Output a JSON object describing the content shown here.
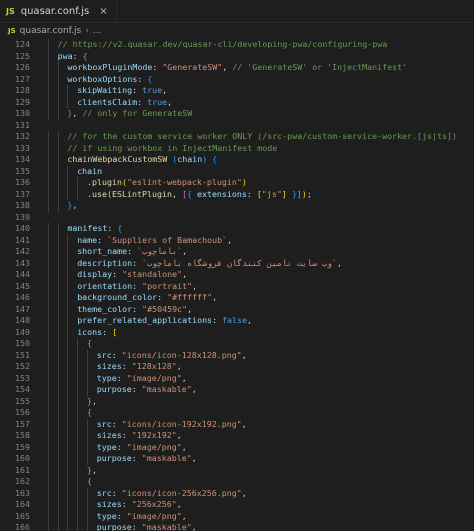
{
  "tab": {
    "badge": "JS",
    "label": "quasar.conf.js",
    "close": "×"
  },
  "breadcrumb": {
    "badge": "JS",
    "file": "quasar.conf.js",
    "sep": "›",
    "tail": "..."
  },
  "lines": [
    {
      "n": "124",
      "indent": 2,
      "tokens": [
        [
          "c",
          "// https://v2.quasar.dev/quasar-cli/developing-pwa/configuring-pwa"
        ]
      ]
    },
    {
      "n": "125",
      "indent": 2,
      "tokens": [
        [
          "k",
          "pwa"
        ],
        [
          "p",
          ": "
        ],
        [
          "b2",
          "{"
        ]
      ]
    },
    {
      "n": "126",
      "indent": 3,
      "tokens": [
        [
          "k",
          "workboxPluginMode"
        ],
        [
          "p",
          ": "
        ],
        [
          "s",
          "\"GenerateSW\""
        ],
        [
          "p",
          ", "
        ],
        [
          "c",
          "// 'GenerateSW' or 'InjectManifest'"
        ]
      ]
    },
    {
      "n": "127",
      "indent": 3,
      "tokens": [
        [
          "k",
          "workboxOptions"
        ],
        [
          "p",
          ": "
        ],
        [
          "b3",
          "{"
        ]
      ]
    },
    {
      "n": "128",
      "indent": 4,
      "tokens": [
        [
          "k",
          "skipWaiting"
        ],
        [
          "p",
          ": "
        ],
        [
          "w",
          "true"
        ],
        [
          "p",
          ","
        ]
      ]
    },
    {
      "n": "129",
      "indent": 4,
      "tokens": [
        [
          "k",
          "clientsClaim"
        ],
        [
          "p",
          ": "
        ],
        [
          "w",
          "true"
        ],
        [
          "p",
          ","
        ]
      ]
    },
    {
      "n": "130",
      "indent": 3,
      "tokens": [
        [
          "b3",
          "}"
        ],
        [
          "p",
          ", "
        ],
        [
          "c",
          "// only for GenerateSW"
        ]
      ]
    },
    {
      "n": "131",
      "indent": 0,
      "tokens": []
    },
    {
      "n": "132",
      "indent": 3,
      "tokens": [
        [
          "c",
          "// for the custom service worker ONLY (/src-pwa/custom-service-worker.[js|ts])"
        ]
      ]
    },
    {
      "n": "133",
      "indent": 3,
      "tokens": [
        [
          "c",
          "// if using workbox in InjectManifest mode"
        ]
      ]
    },
    {
      "n": "134",
      "indent": 3,
      "tokens": [
        [
          "f",
          "chainWebpackCustomSW"
        ],
        [
          "p",
          " "
        ],
        [
          "b3",
          "("
        ],
        [
          "k",
          "chain"
        ],
        [
          "b3",
          ")"
        ],
        [
          "p",
          " "
        ],
        [
          "b3",
          "{"
        ]
      ]
    },
    {
      "n": "135",
      "indent": 4,
      "tokens": [
        [
          "k",
          "chain"
        ]
      ]
    },
    {
      "n": "136",
      "indent": 5,
      "tokens": [
        [
          "p",
          "."
        ],
        [
          "f",
          "plugin"
        ],
        [
          "b1",
          "("
        ],
        [
          "s",
          "\"eslint-webpack-plugin\""
        ],
        [
          "b1",
          ")"
        ]
      ]
    },
    {
      "n": "137",
      "indent": 5,
      "tokens": [
        [
          "p",
          "."
        ],
        [
          "f",
          "use"
        ],
        [
          "b1",
          "("
        ],
        [
          "f",
          "ESLintPlugin"
        ],
        [
          "p",
          ", "
        ],
        [
          "b2",
          "["
        ],
        [
          "b3",
          "{"
        ],
        [
          "p",
          " "
        ],
        [
          "k",
          "extensions"
        ],
        [
          "p",
          ": "
        ],
        [
          "b1",
          "["
        ],
        [
          "s",
          "\"js\""
        ],
        [
          "b1",
          "]"
        ],
        [
          "p",
          " "
        ],
        [
          "b3",
          "}"
        ],
        [
          "b2",
          "]"
        ],
        [
          "b1",
          ")"
        ],
        [
          "p",
          ";"
        ]
      ]
    },
    {
      "n": "138",
      "indent": 3,
      "tokens": [
        [
          "b3",
          "}"
        ],
        [
          "p",
          ","
        ]
      ]
    },
    {
      "n": "139",
      "indent": 0,
      "tokens": []
    },
    {
      "n": "140",
      "indent": 3,
      "tokens": [
        [
          "k",
          "manifest"
        ],
        [
          "p",
          ": "
        ],
        [
          "b3",
          "{"
        ]
      ]
    },
    {
      "n": "141",
      "indent": 4,
      "tokens": [
        [
          "k",
          "name"
        ],
        [
          "p",
          ": "
        ],
        [
          "s",
          "`Suppliers of Bamachoub`"
        ],
        [
          "p",
          ","
        ]
      ]
    },
    {
      "n": "142",
      "indent": 4,
      "tokens": [
        [
          "k",
          "short_name"
        ],
        [
          "p",
          ": "
        ],
        [
          "s",
          "`باماچوب`"
        ],
        [
          "p",
          ","
        ]
      ]
    },
    {
      "n": "143",
      "indent": 4,
      "tokens": [
        [
          "k",
          "description"
        ],
        [
          "p",
          ": "
        ],
        [
          "s",
          "`وب سایت تامین کنندگان فروشگاه باماچوب`"
        ],
        [
          "p",
          ","
        ]
      ]
    },
    {
      "n": "144",
      "indent": 4,
      "tokens": [
        [
          "k",
          "display"
        ],
        [
          "p",
          ": "
        ],
        [
          "s",
          "\"standalone\""
        ],
        [
          "p",
          ","
        ]
      ]
    },
    {
      "n": "145",
      "indent": 4,
      "tokens": [
        [
          "k",
          "orientation"
        ],
        [
          "p",
          ": "
        ],
        [
          "s",
          "\"portrait\""
        ],
        [
          "p",
          ","
        ]
      ]
    },
    {
      "n": "146",
      "indent": 4,
      "tokens": [
        [
          "k",
          "background_color"
        ],
        [
          "p",
          ": "
        ],
        [
          "s",
          "\"#ffffff\""
        ],
        [
          "p",
          ","
        ]
      ]
    },
    {
      "n": "147",
      "indent": 4,
      "tokens": [
        [
          "k",
          "theme_color"
        ],
        [
          "p",
          ": "
        ],
        [
          "s",
          "\"#50459c\""
        ],
        [
          "p",
          ","
        ]
      ]
    },
    {
      "n": "148",
      "indent": 4,
      "tokens": [
        [
          "k",
          "prefer_related_applications"
        ],
        [
          "p",
          ": "
        ],
        [
          "w",
          "false"
        ],
        [
          "p",
          ","
        ]
      ]
    },
    {
      "n": "149",
      "indent": 4,
      "tokens": [
        [
          "k",
          "icons"
        ],
        [
          "p",
          ": "
        ],
        [
          "b1",
          "["
        ]
      ]
    },
    {
      "n": "150",
      "indent": 5,
      "tokens": [
        [
          "b2",
          "{"
        ]
      ]
    },
    {
      "n": "151",
      "indent": 6,
      "tokens": [
        [
          "k",
          "src"
        ],
        [
          "p",
          ": "
        ],
        [
          "s",
          "\"icons/icon-128x128.png\""
        ],
        [
          "p",
          ","
        ]
      ]
    },
    {
      "n": "152",
      "indent": 6,
      "tokens": [
        [
          "k",
          "sizes"
        ],
        [
          "p",
          ": "
        ],
        [
          "s",
          "\"128x128\""
        ],
        [
          "p",
          ","
        ]
      ]
    },
    {
      "n": "153",
      "indent": 6,
      "tokens": [
        [
          "k",
          "type"
        ],
        [
          "p",
          ": "
        ],
        [
          "s",
          "\"image/png\""
        ],
        [
          "p",
          ","
        ]
      ]
    },
    {
      "n": "154",
      "indent": 6,
      "tokens": [
        [
          "k",
          "purpose"
        ],
        [
          "p",
          ": "
        ],
        [
          "s",
          "\"maskable\""
        ],
        [
          "p",
          ","
        ]
      ]
    },
    {
      "n": "155",
      "indent": 5,
      "tokens": [
        [
          "b2",
          "}"
        ],
        [
          "p",
          ","
        ]
      ]
    },
    {
      "n": "156",
      "indent": 5,
      "tokens": [
        [
          "b2",
          "{"
        ]
      ]
    },
    {
      "n": "157",
      "indent": 6,
      "tokens": [
        [
          "k",
          "src"
        ],
        [
          "p",
          ": "
        ],
        [
          "s",
          "\"icons/icon-192x192.png\""
        ],
        [
          "p",
          ","
        ]
      ]
    },
    {
      "n": "158",
      "indent": 6,
      "tokens": [
        [
          "k",
          "sizes"
        ],
        [
          "p",
          ": "
        ],
        [
          "s",
          "\"192x192\""
        ],
        [
          "p",
          ","
        ]
      ]
    },
    {
      "n": "159",
      "indent": 6,
      "tokens": [
        [
          "k",
          "type"
        ],
        [
          "p",
          ": "
        ],
        [
          "s",
          "\"image/png\""
        ],
        [
          "p",
          ","
        ]
      ]
    },
    {
      "n": "160",
      "indent": 6,
      "tokens": [
        [
          "k",
          "purpose"
        ],
        [
          "p",
          ": "
        ],
        [
          "s",
          "\"maskable\""
        ],
        [
          "p",
          ","
        ]
      ]
    },
    {
      "n": "161",
      "indent": 5,
      "tokens": [
        [
          "b2",
          "}"
        ],
        [
          "p",
          ","
        ]
      ]
    },
    {
      "n": "162",
      "indent": 5,
      "tokens": [
        [
          "b2",
          "{"
        ]
      ]
    },
    {
      "n": "163",
      "indent": 6,
      "tokens": [
        [
          "k",
          "src"
        ],
        [
          "p",
          ": "
        ],
        [
          "s",
          "\"icons/icon-256x256.png\""
        ],
        [
          "p",
          ","
        ]
      ]
    },
    {
      "n": "164",
      "indent": 6,
      "tokens": [
        [
          "k",
          "sizes"
        ],
        [
          "p",
          ": "
        ],
        [
          "s",
          "\"256x256\""
        ],
        [
          "p",
          ","
        ]
      ]
    },
    {
      "n": "165",
      "indent": 6,
      "tokens": [
        [
          "k",
          "type"
        ],
        [
          "p",
          ": "
        ],
        [
          "s",
          "\"image/png\""
        ],
        [
          "p",
          ","
        ]
      ]
    },
    {
      "n": "166",
      "indent": 6,
      "tokens": [
        [
          "k",
          "purpose"
        ],
        [
          "p",
          ": "
        ],
        [
          "s",
          "\"maskable\""
        ],
        [
          "p",
          ","
        ]
      ]
    },
    {
      "n": "167",
      "indent": 5,
      "tokens": [
        [
          "b2",
          "}"
        ],
        [
          "p",
          ","
        ]
      ]
    },
    {
      "n": "168",
      "indent": 5,
      "tokens": [
        [
          "b2",
          "{"
        ]
      ]
    }
  ]
}
